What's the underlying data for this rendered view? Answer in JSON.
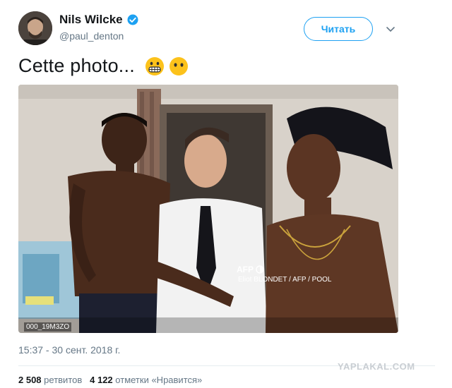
{
  "header": {
    "display_name": "Nils Wilcke",
    "handle": "@paul_denton",
    "follow_label": "Читать"
  },
  "tweet": {
    "text": "Cette photo...",
    "emojis": [
      "grimacing-face",
      "face-without-mouth"
    ],
    "timestamp": "15:37 - 30 сент. 2018 г."
  },
  "photo": {
    "agency_logo": "AFP",
    "credit": "Eliot BLONDET / AFP / POOL",
    "photo_id": "000_19M3ZO"
  },
  "stats": {
    "retweets_count": "2 508",
    "retweets_label": "ретвитов",
    "likes_count": "4 122",
    "likes_label": "отметки «Нравится»"
  },
  "site_watermark": "YAPLAKAL.COM",
  "colors": {
    "accent": "#1da1f2",
    "muted": "#657786",
    "text": "#14171a"
  }
}
